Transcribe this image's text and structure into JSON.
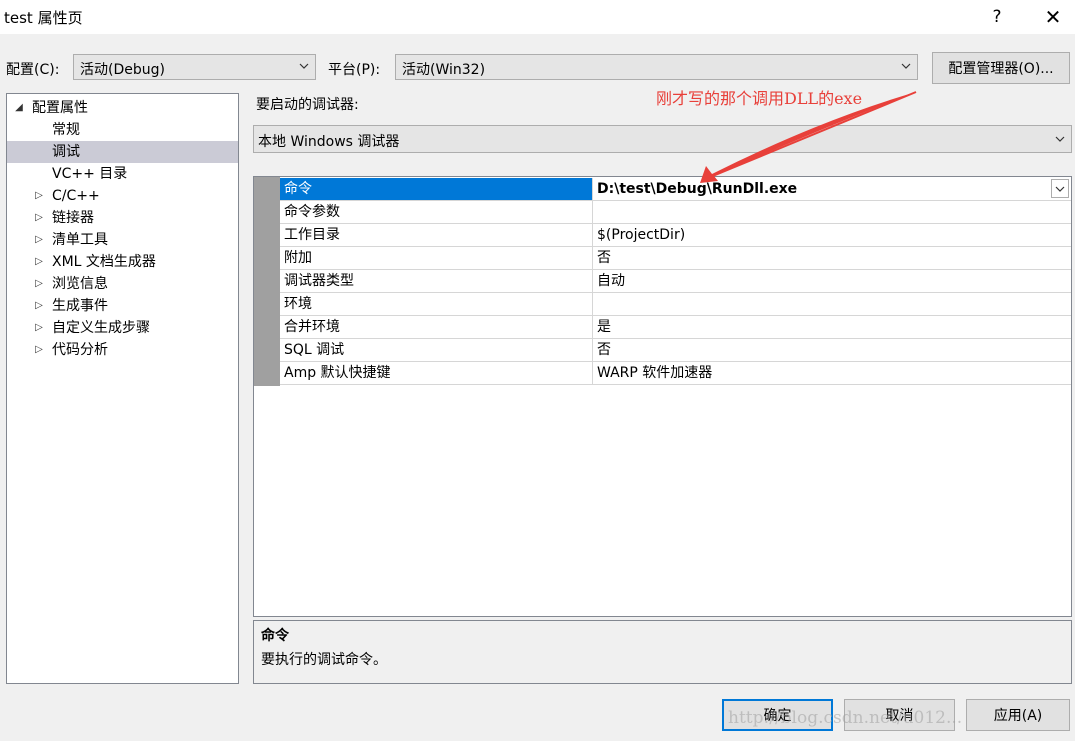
{
  "window": {
    "title": "test 属性页",
    "help": "?",
    "close": "✕"
  },
  "config": {
    "label": "配置(C):",
    "value": "活动(Debug)"
  },
  "platform": {
    "label": "平台(P):",
    "value": "活动(Win32)"
  },
  "manager_button": "配置管理器(O)...",
  "tree": {
    "root": "配置属性",
    "items": [
      "常规",
      "调试",
      "VC++ 目录",
      "C/C++",
      "链接器",
      "清单工具",
      "XML 文档生成器",
      "浏览信息",
      "生成事件",
      "自定义生成步骤",
      "代码分析"
    ],
    "selected": "调试"
  },
  "debugger": {
    "label": "要启动的调试器:",
    "value": "本地 Windows 调试器"
  },
  "grid": {
    "rows": [
      {
        "name": "命令",
        "value": "D:\\test\\Debug\\RunDll.exe"
      },
      {
        "name": "命令参数",
        "value": ""
      },
      {
        "name": "工作目录",
        "value": "$(ProjectDir)"
      },
      {
        "name": "附加",
        "value": "否"
      },
      {
        "name": "调试器类型",
        "value": "自动"
      },
      {
        "name": "环境",
        "value": ""
      },
      {
        "name": "合并环境",
        "value": "是"
      },
      {
        "name": "SQL 调试",
        "value": "否"
      },
      {
        "name": "Amp 默认快捷键",
        "value": "WARP 软件加速器"
      }
    ]
  },
  "description": {
    "title": "命令",
    "text": "要执行的调试命令。"
  },
  "buttons": {
    "ok": "确定",
    "cancel": "取消",
    "apply": "应用(A)"
  },
  "annotation": {
    "text": "刚才写的那个调用DLL的exe",
    "color": "#e8403a"
  },
  "watermark": "http://blog.csdn.net/u012..."
}
